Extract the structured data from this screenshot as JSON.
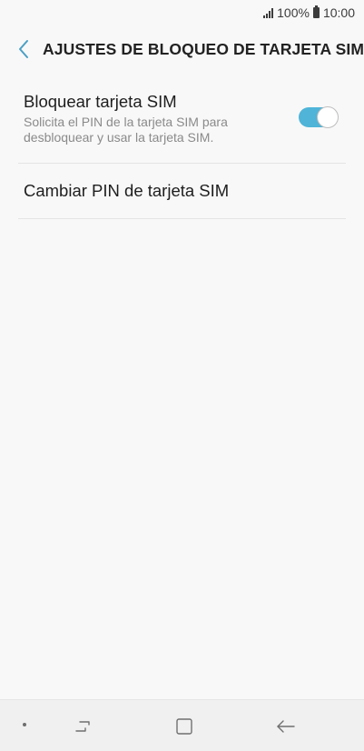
{
  "status_bar": {
    "battery_percent": "100%",
    "time": "10:00"
  },
  "header": {
    "title": "AJUSTES DE BLOQUEO DE TARJETA SIM",
    "back_icon": "chevron-left-icon"
  },
  "settings": {
    "sim_lock": {
      "title": "Bloquear tarjeta SIM",
      "summary": "Solicita el PIN de la tarjeta SIM para desbloquear y usar la tarjeta SIM.",
      "enabled": true
    },
    "change_pin": {
      "title": "Cambiar PIN de tarjeta SIM"
    }
  },
  "nav_bar": {
    "icons": [
      "recents-icon",
      "home-icon",
      "back-arrow-icon"
    ]
  },
  "colors": {
    "accent": "#4fb4d8",
    "background": "#f8f8f8",
    "nav_background": "#f0f0f0"
  }
}
